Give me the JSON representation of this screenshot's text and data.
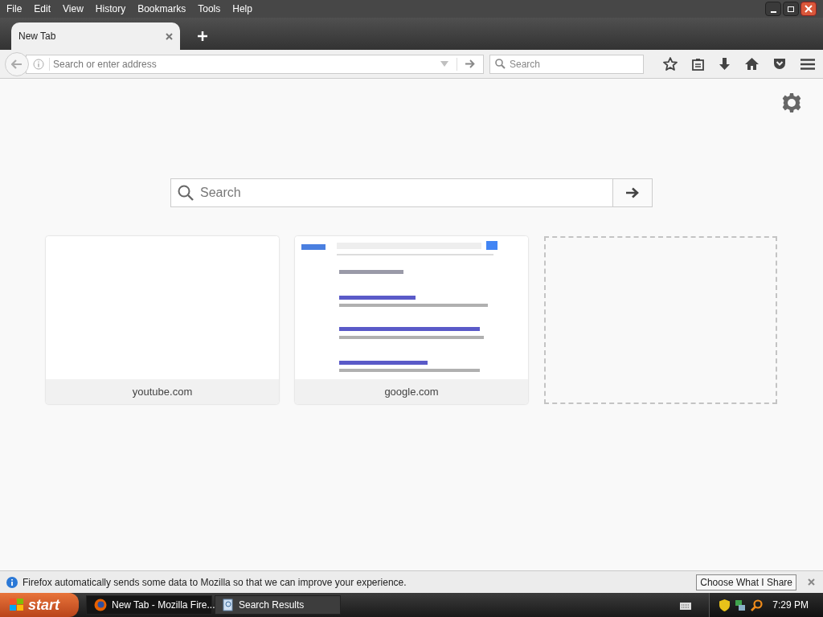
{
  "menu": [
    "File",
    "Edit",
    "View",
    "History",
    "Bookmarks",
    "Tools",
    "Help"
  ],
  "tabs": [
    {
      "label": "New Tab",
      "selected": true
    }
  ],
  "toolbar": {
    "address_placeholder": "Search or enter address",
    "search_placeholder": "Search"
  },
  "page": {
    "search_placeholder": "Search",
    "tiles": [
      {
        "kind": "blank",
        "label": "youtube.com"
      },
      {
        "kind": "thumbnail",
        "label": "google.com"
      },
      {
        "kind": "empty"
      }
    ]
  },
  "notification": {
    "text": "Firefox automatically sends some data to Mozilla so that we can improve your experience.",
    "button": "Choose What I Share"
  },
  "taskbar": {
    "start": "start",
    "items": [
      {
        "label": "New Tab - Mozilla Fire...",
        "selected": true,
        "kind": "firefox"
      },
      {
        "label": "Search Results",
        "selected": false,
        "kind": "search"
      }
    ],
    "clock": "7:29 PM"
  }
}
